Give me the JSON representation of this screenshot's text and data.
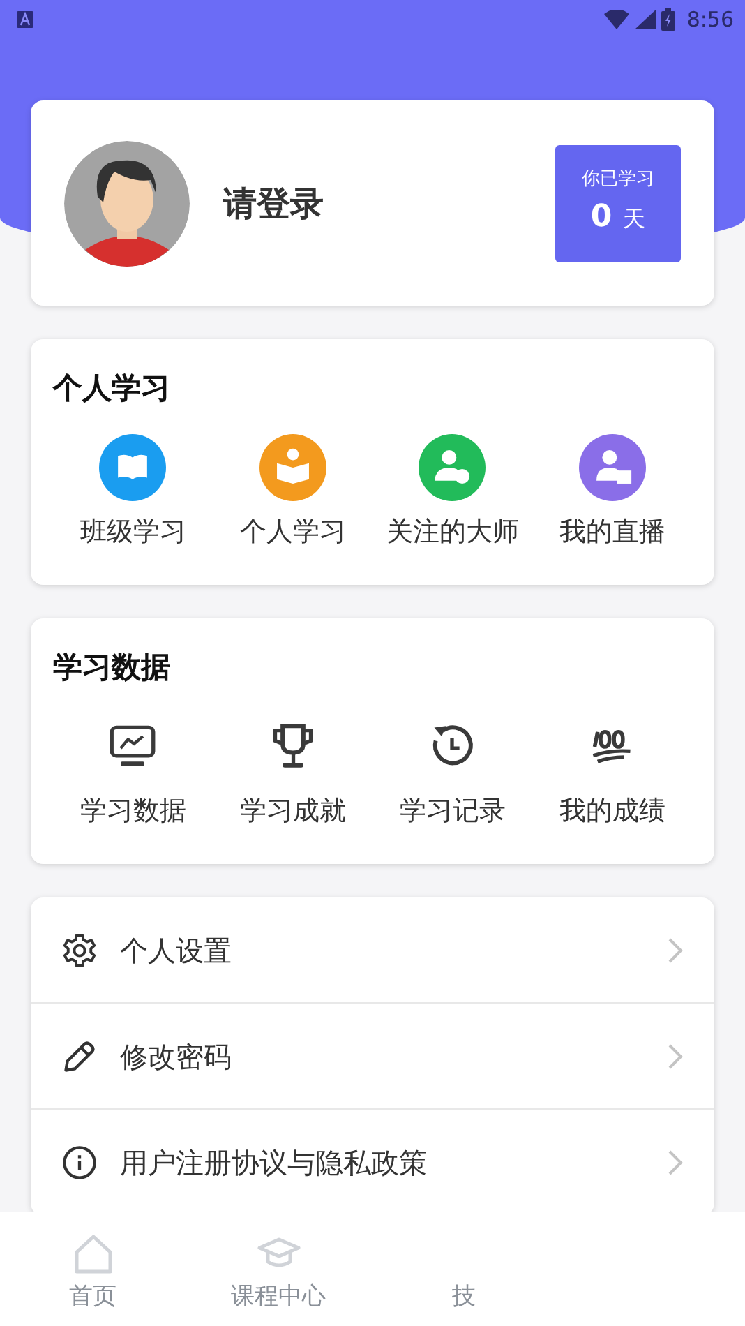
{
  "status_bar": {
    "time": "8:56"
  },
  "profile": {
    "login_text": "请登录",
    "study_label": "你已学习",
    "study_days": "0",
    "days_unit": "天"
  },
  "sections": [
    {
      "title": "个人学习",
      "items": [
        {
          "label": "班级学习",
          "kind": "book",
          "color": "#1a9df0"
        },
        {
          "label": "个人学习",
          "kind": "reader",
          "color": "#f39a1e"
        },
        {
          "label": "关注的大师",
          "kind": "teacher",
          "color": "#22bb5a"
        },
        {
          "label": "我的直播",
          "kind": "live",
          "color": "#8a6ee8"
        }
      ]
    },
    {
      "title": "学习数据",
      "items": [
        {
          "label": "学习数据",
          "kind": "monitor"
        },
        {
          "label": "学习成就",
          "kind": "trophy"
        },
        {
          "label": "学习记录",
          "kind": "history"
        },
        {
          "label": "我的成绩",
          "kind": "hundred"
        }
      ]
    }
  ],
  "menu": [
    {
      "label": "个人设置",
      "kind": "gear"
    },
    {
      "label": "修改密码",
      "kind": "pencil"
    },
    {
      "label": "用户注册协议与隐私政策",
      "kind": "info"
    }
  ],
  "bottom_nav": [
    {
      "label": "首页",
      "kind": "home"
    },
    {
      "label": "课程中心",
      "kind": "cap"
    },
    {
      "label": "技",
      "kind": "none"
    }
  ]
}
